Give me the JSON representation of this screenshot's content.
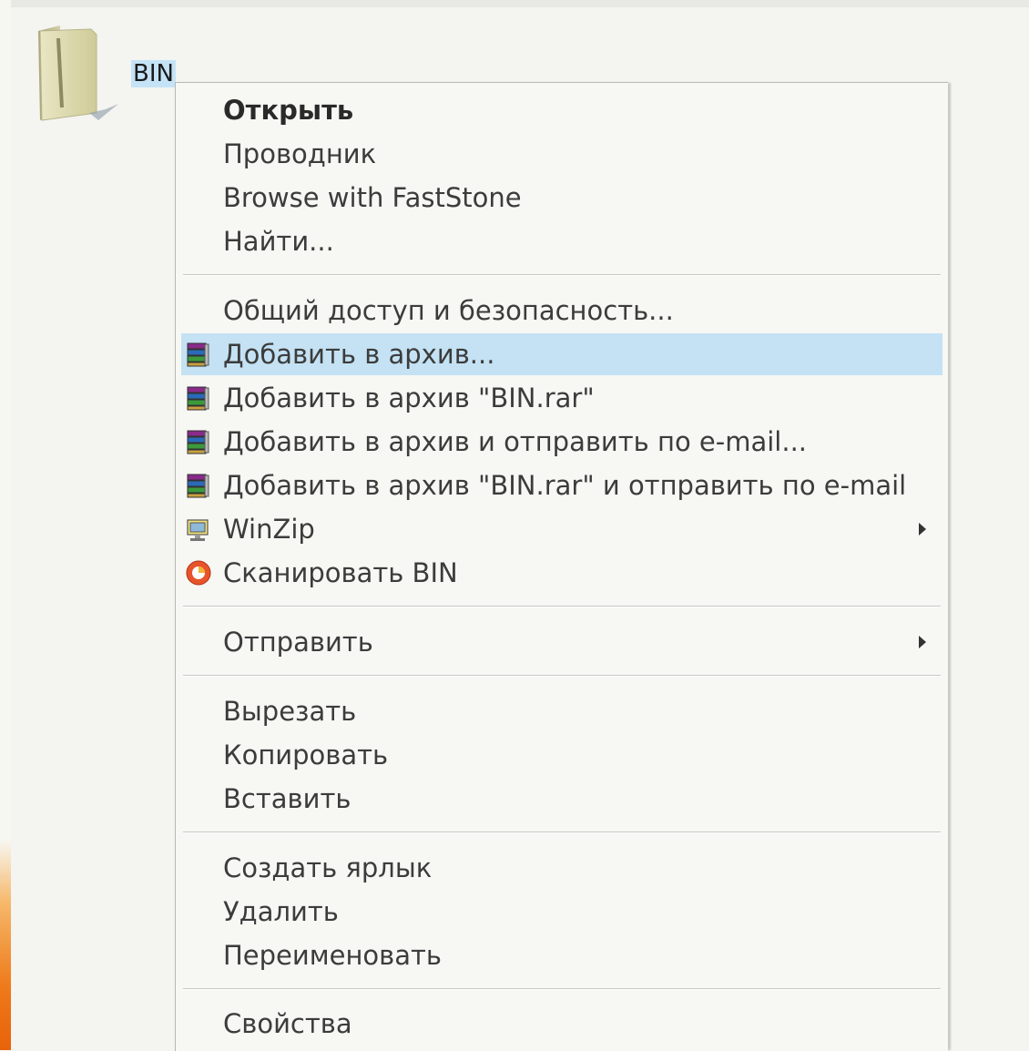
{
  "desktop": {
    "folder": {
      "name": "BIN",
      "icon": "folder-icon"
    }
  },
  "context_menu": {
    "items": [
      {
        "label": "Открыть",
        "bold": true
      },
      {
        "label": "Проводник"
      },
      {
        "label": "Browse with FastStone"
      },
      {
        "label": "Найти..."
      },
      {
        "label": "Общий доступ и безопасность..."
      },
      {
        "label": "Добавить в архив...",
        "icon": "winrar-icon",
        "highlighted": true
      },
      {
        "label": "Добавить в архив \"BIN.rar\"",
        "icon": "winrar-icon"
      },
      {
        "label": "Добавить в архив и отправить по e-mail...",
        "icon": "winrar-icon"
      },
      {
        "label": "Добавить в архив \"BIN.rar\" и отправить по e-mail",
        "icon": "winrar-icon"
      },
      {
        "label": "WinZip",
        "icon": "winzip-icon",
        "submenu": true
      },
      {
        "label": "Сканировать BIN",
        "icon": "antivirus-scan-icon"
      },
      {
        "label": "Отправить",
        "submenu": true
      },
      {
        "label": "Вырезать"
      },
      {
        "label": "Копировать"
      },
      {
        "label": "Вставить"
      },
      {
        "label": "Создать ярлык"
      },
      {
        "label": "Удалить"
      },
      {
        "label": "Переименовать"
      },
      {
        "label": "Свойства"
      }
    ]
  },
  "colors": {
    "highlight": "#c4e2f4",
    "menu_background": "#f7f7f3",
    "text": "#3c3c3c"
  }
}
